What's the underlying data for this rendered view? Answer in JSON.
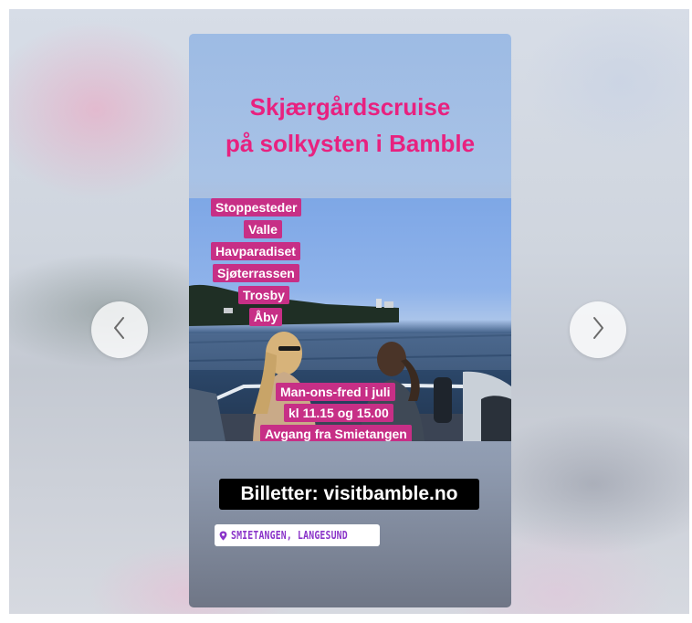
{
  "story": {
    "headline_line1": "Skjærgårdscruise",
    "headline_line2": "på solkysten i Bamble",
    "stops": [
      "Stoppesteder",
      "Valle",
      "Havparadiset",
      "Sjøterrassen",
      "Trosby",
      "Åby"
    ],
    "schedule": [
      "Man-ons-fred i juli",
      "kl 11.15 og 15.00",
      "Avgang fra Smietangen"
    ],
    "cta": "Billetter: visitbamble.no",
    "location": "SMIETANGEN, LANGESUND"
  },
  "navigation": {
    "prev_icon": "chevron-left-icon",
    "next_icon": "chevron-right-icon"
  },
  "colors": {
    "headline": "#e8217f",
    "tag_background": "#c72f86",
    "location_text": "#8b35c9"
  }
}
